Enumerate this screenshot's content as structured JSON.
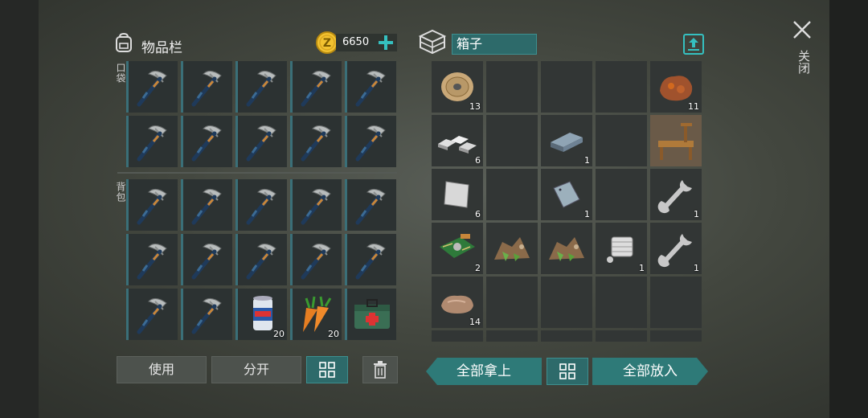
{
  "inventory": {
    "title": "物品栏",
    "coins": "6650",
    "pocket_label": "口袋",
    "backpack_label": "背包",
    "pocket_slots": [
      {
        "item": "pickaxe",
        "count": ""
      },
      {
        "item": "pickaxe",
        "count": ""
      },
      {
        "item": "pickaxe",
        "count": ""
      },
      {
        "item": "pickaxe",
        "count": ""
      },
      {
        "item": "pickaxe",
        "count": ""
      },
      {
        "item": "pickaxe",
        "count": ""
      },
      {
        "item": "pickaxe",
        "count": ""
      },
      {
        "item": "pickaxe",
        "count": ""
      },
      {
        "item": "pickaxe",
        "count": ""
      },
      {
        "item": "pickaxe",
        "count": ""
      }
    ],
    "backpack_slots": [
      {
        "item": "pickaxe",
        "count": ""
      },
      {
        "item": "pickaxe",
        "count": ""
      },
      {
        "item": "pickaxe",
        "count": ""
      },
      {
        "item": "pickaxe",
        "count": ""
      },
      {
        "item": "pickaxe",
        "count": ""
      },
      {
        "item": "pickaxe",
        "count": ""
      },
      {
        "item": "pickaxe",
        "count": ""
      },
      {
        "item": "pickaxe",
        "count": ""
      },
      {
        "item": "pickaxe",
        "count": ""
      },
      {
        "item": "pickaxe",
        "count": ""
      },
      {
        "item": "pickaxe",
        "count": ""
      },
      {
        "item": "pickaxe",
        "count": ""
      },
      {
        "item": "soda-can",
        "count": "20"
      },
      {
        "item": "carrots",
        "count": "20"
      },
      {
        "item": "first-aid-kit",
        "count": ""
      }
    ],
    "buttons": {
      "use": "使用",
      "split": "分开"
    }
  },
  "chest": {
    "name": "箱子",
    "slots": [
      {
        "item": "wire-spool",
        "count": "13"
      },
      {
        "item": "",
        "count": ""
      },
      {
        "item": "",
        "count": ""
      },
      {
        "item": "",
        "count": ""
      },
      {
        "item": "copper-ore",
        "count": "11"
      },
      {
        "item": "metal-bars",
        "count": "6"
      },
      {
        "item": "",
        "count": ""
      },
      {
        "item": "iron-ingot",
        "count": "1"
      },
      {
        "item": "",
        "count": ""
      },
      {
        "item": "workbench",
        "count": ""
      },
      {
        "item": "metal-sheet",
        "count": "6"
      },
      {
        "item": "",
        "count": ""
      },
      {
        "item": "metal-plate",
        "count": "1"
      },
      {
        "item": "",
        "count": ""
      },
      {
        "item": "wrench",
        "count": "1"
      },
      {
        "item": "circuit-board",
        "count": "2"
      },
      {
        "item": "ore-pile",
        "count": ""
      },
      {
        "item": "ore-pile",
        "count": ""
      },
      {
        "item": "engine-part",
        "count": "1"
      },
      {
        "item": "wrench",
        "count": "1"
      },
      {
        "item": "stone",
        "count": "14"
      },
      {
        "item": "",
        "count": ""
      },
      {
        "item": "",
        "count": ""
      },
      {
        "item": "",
        "count": ""
      },
      {
        "item": "",
        "count": ""
      }
    ],
    "buttons": {
      "take_all": "全部拿上",
      "put_all": "全部放入"
    }
  },
  "close_label": "关闭",
  "colors": {
    "accent": "#2e7a78",
    "coin": "#f2c230",
    "plus": "#35c0c0"
  }
}
